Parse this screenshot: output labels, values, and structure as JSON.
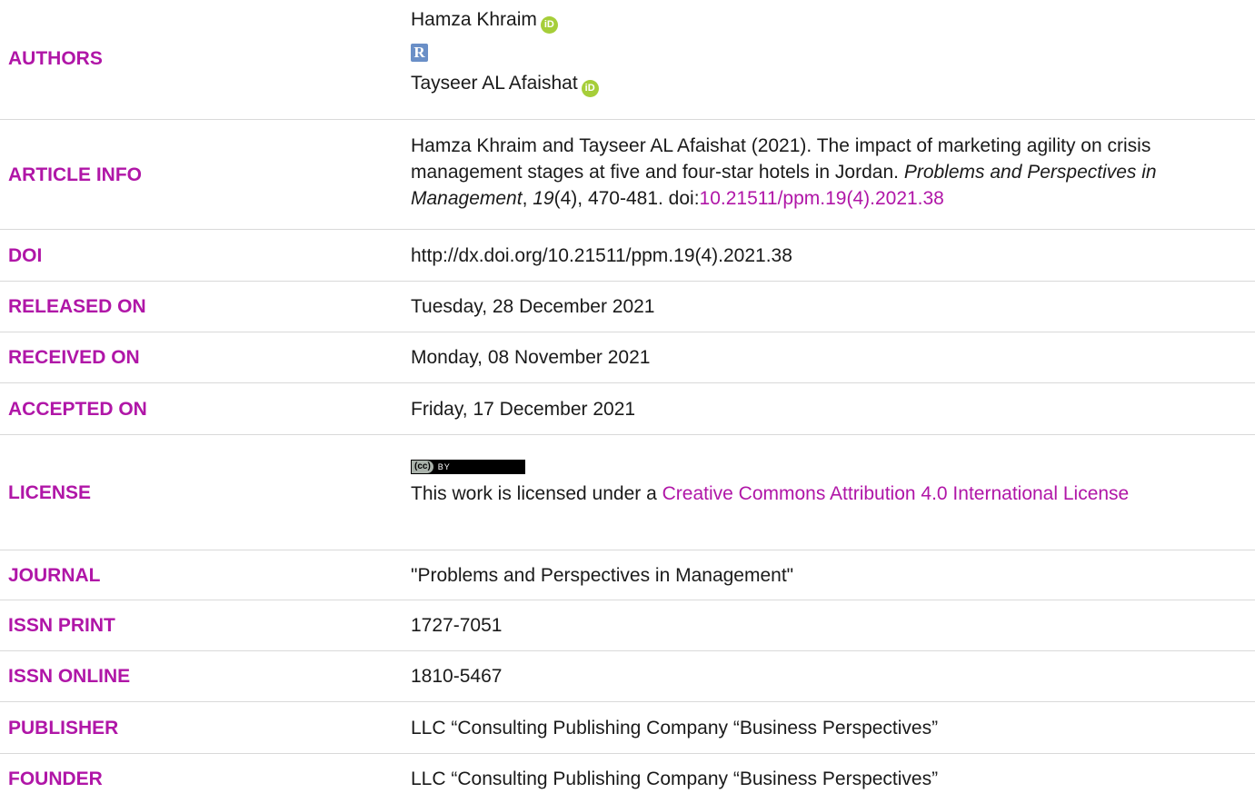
{
  "rows": {
    "authors": {
      "label": "AUTHORS",
      "names": [
        "Hamza Khraim",
        "Tayseer AL Afaishat"
      ],
      "orcid_icon": "iD",
      "researcherid_icon": "R"
    },
    "article_info": {
      "label": "ARTICLE INFO",
      "text_before": "Hamza Khraim and Tayseer AL Afaishat (2021). The impact of marketing agility on crisis management stages at five and four-star hotels in Jordan. ",
      "journal_italic": "Problems and Perspectives in Management",
      "comma": ", ",
      "volume_italic": "19",
      "issue_pages": "(4), 470-481. doi:",
      "doi_link": "10.21511/ppm.19(4).2021.38"
    },
    "doi": {
      "label": "DOI",
      "value": "http://dx.doi.org/10.21511/ppm.19(4).2021.38"
    },
    "released": {
      "label": "RELEASED ON",
      "value": "Tuesday, 28 December 2021"
    },
    "received": {
      "label": "RECEIVED ON",
      "value": "Monday, 08 November 2021"
    },
    "accepted": {
      "label": "ACCEPTED ON",
      "value": "Friday, 17 December 2021"
    },
    "license": {
      "label": "LICENSE",
      "badge_left": "(cc)",
      "badge_right": "BY",
      "text": "This work is licensed under a ",
      "link": "Creative Commons Attribution 4.0 International License"
    },
    "journal": {
      "label": "JOURNAL",
      "value": "\"Problems and Perspectives in Management\""
    },
    "issn_print": {
      "label": "ISSN PRINT",
      "value": "1727-7051"
    },
    "issn_online": {
      "label": "ISSN ONLINE",
      "value": "1810-5467"
    },
    "publisher": {
      "label": "PUBLISHER",
      "value": "LLC “Consulting Publishing Company “Business Perspectives”"
    },
    "founder": {
      "label": "FOUNDER",
      "value": "LLC “Consulting Publishing Company “Business Perspectives”"
    }
  },
  "colors": {
    "label": "#b016a7",
    "link": "#b016a7",
    "text": "#1a1a1a",
    "divider": "#d9d9d9",
    "orcid": "#a6ce39"
  }
}
